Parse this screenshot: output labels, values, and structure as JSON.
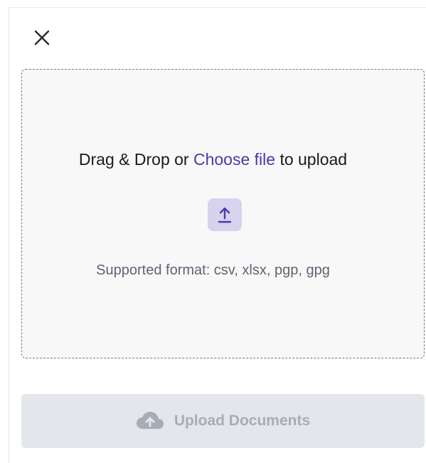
{
  "dialog": {
    "close_icon": "close-icon"
  },
  "dropzone": {
    "text_before": "Drag & Drop or",
    "choose_file": "Choose file",
    "text_after": "to upload",
    "upload_icon": "upload-arrow-icon",
    "supported_formats": "Supported format: csv, xlsx, pgp, gpg"
  },
  "footer": {
    "upload_button_label": "Upload Documents",
    "upload_button_icon": "cloud-upload-icon",
    "upload_button_enabled": false
  },
  "colors": {
    "accent": "#4a3aa6",
    "badge_bg": "#d8d2ef",
    "disabled_bg": "#e3e6ea",
    "disabled_text": "#a7adb6"
  }
}
